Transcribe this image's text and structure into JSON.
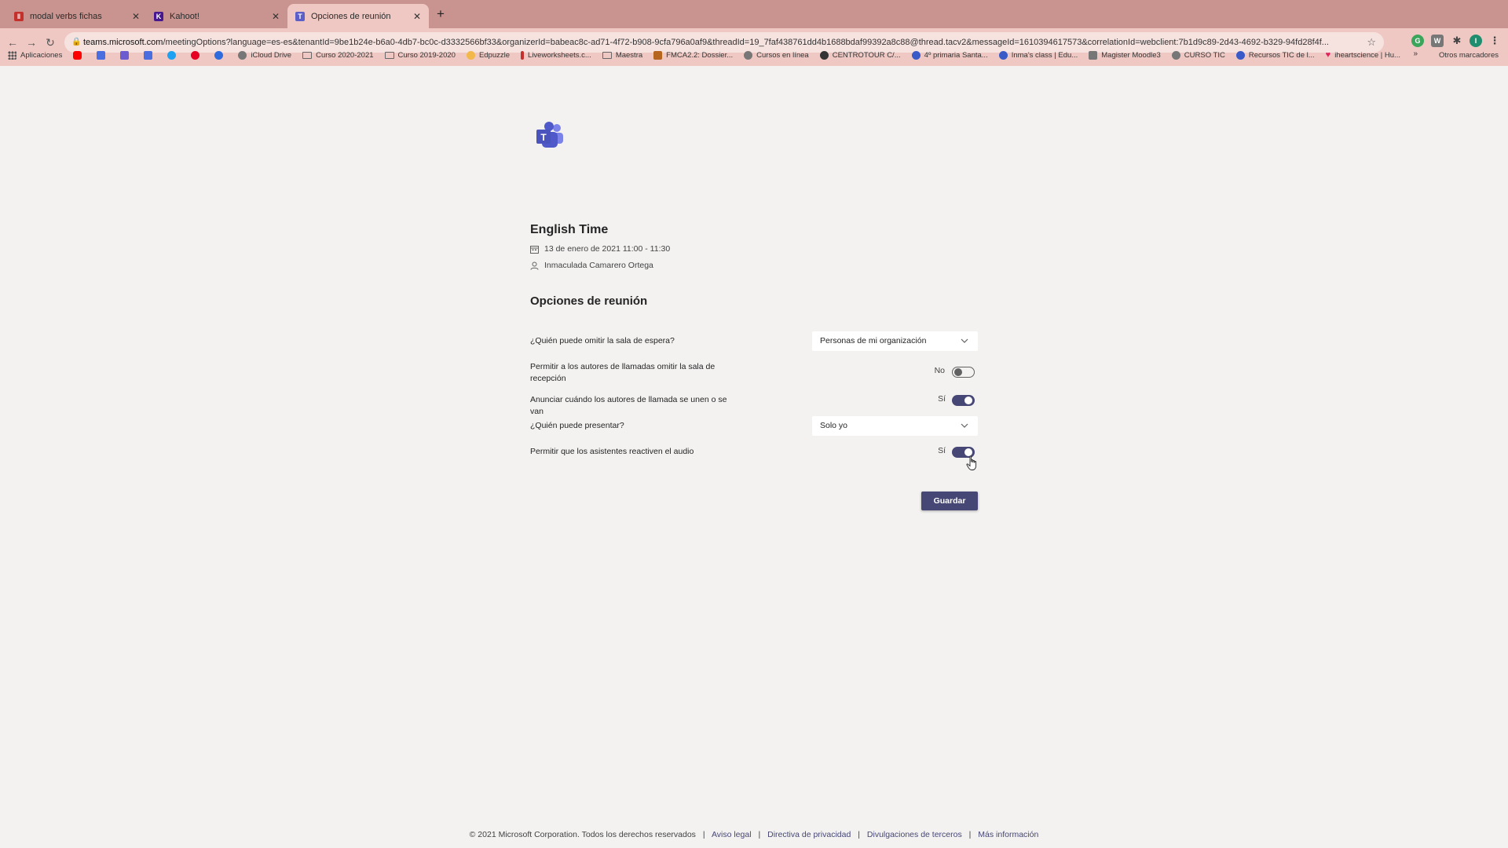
{
  "browser": {
    "tabs": [
      {
        "title": "modal verbs fichas",
        "favicon_color": "#c4302b",
        "active": false
      },
      {
        "title": "Kahoot!",
        "favicon_color": "#46178f",
        "active": false
      },
      {
        "title": "Opciones de reunión",
        "favicon_color": "#5b5fc7",
        "active": true
      }
    ],
    "url_host": "teams.microsoft.com",
    "url_path": "/meetingOptions?language=es-es&tenantId=9be1b24e-b6a0-4db7-bc0c-d3332566bf33&organizerId=babeac8c-ad71-4f72-b908-9cfa796a0af9&threadId=19_7faf438761dd4b1688bdaf99392a8c88@thread.tacv2&messageId=1610394617573&correlationId=webclient:7b1d9c89-2d43-4692-b329-94fd28f4f...",
    "bookmarks": [
      {
        "label": "Aplicaciones",
        "color": "#555555"
      },
      {
        "label": "",
        "color": "#ff0000"
      },
      {
        "label": "",
        "color": "#4a6ee0"
      },
      {
        "label": "",
        "color": "#6d5bd0"
      },
      {
        "label": "",
        "color": "#4a6ee0"
      },
      {
        "label": "",
        "color": "#1da1f2"
      },
      {
        "label": "",
        "color": "#e60023"
      },
      {
        "label": "",
        "color": "#2e6bdc"
      },
      {
        "label": "iCloud Drive",
        "color": "#777777"
      },
      {
        "label": "Curso 2020-2021",
        "folder": true
      },
      {
        "label": "Curso 2019-2020",
        "folder": true
      },
      {
        "label": "Edpuzzle",
        "color": "#f2b84b"
      },
      {
        "label": "Liveworksheets.c...",
        "color": "#c4302b"
      },
      {
        "label": "Maestra",
        "folder": true
      },
      {
        "label": "FMCA2.2: Dossier...",
        "color": "#b5651d"
      },
      {
        "label": "Cursos en línea",
        "color": "#777777"
      },
      {
        "label": "CENTROTOUR C/...",
        "color": "#333333"
      },
      {
        "label": "4º primaria Santa...",
        "color": "#3a5bc7"
      },
      {
        "label": "Inma's class | Edu...",
        "color": "#3a5bc7"
      },
      {
        "label": "Magister Moodle3",
        "color": "#777777"
      },
      {
        "label": "CURSO TIC",
        "color": "#777777"
      },
      {
        "label": "Recursos TIC de l...",
        "color": "#3a5bc7"
      },
      {
        "label": "iheartscience | Hu...",
        "color": "#e0245e"
      }
    ],
    "bookmarks_more": "»",
    "other_bookmarks": "Otros marcadores"
  },
  "meeting": {
    "title": "English Time",
    "datetime": "13 de enero de 2021 11:00 - 11:30",
    "organizer": "Inmaculada Camarero Ortega"
  },
  "options": {
    "heading": "Opciones de reunión",
    "lobby_bypass_label": "¿Quién puede omitir la sala de espera?",
    "lobby_bypass_value": "Personas de mi organización",
    "callers_bypass_label": "Permitir a los autores de llamadas omitir la sala de recepción",
    "callers_bypass_state": "No",
    "callers_bypass_on": false,
    "announce_label": "Anunciar cuándo los autores de llamada se unen o se van",
    "announce_state": "Sí",
    "announce_on": true,
    "presenters_label": "¿Quién puede presentar?",
    "presenters_value": "Solo yo",
    "unmute_label": "Permitir que los asistentes reactiven el audio",
    "unmute_state": "Sí",
    "unmute_on": true,
    "save_label": "Guardar"
  },
  "footer": {
    "copyright": "© 2021 Microsoft Corporation. Todos los derechos reservados",
    "links": [
      "Aviso legal",
      "Directiva de privacidad",
      "Divulgaciones de terceros",
      "Más información"
    ]
  },
  "colors": {
    "accent": "#464775",
    "page_bg": "#f3f2f1",
    "browser_tabstrip": "#c9948f",
    "browser_toolbar": "#efc8c3"
  }
}
